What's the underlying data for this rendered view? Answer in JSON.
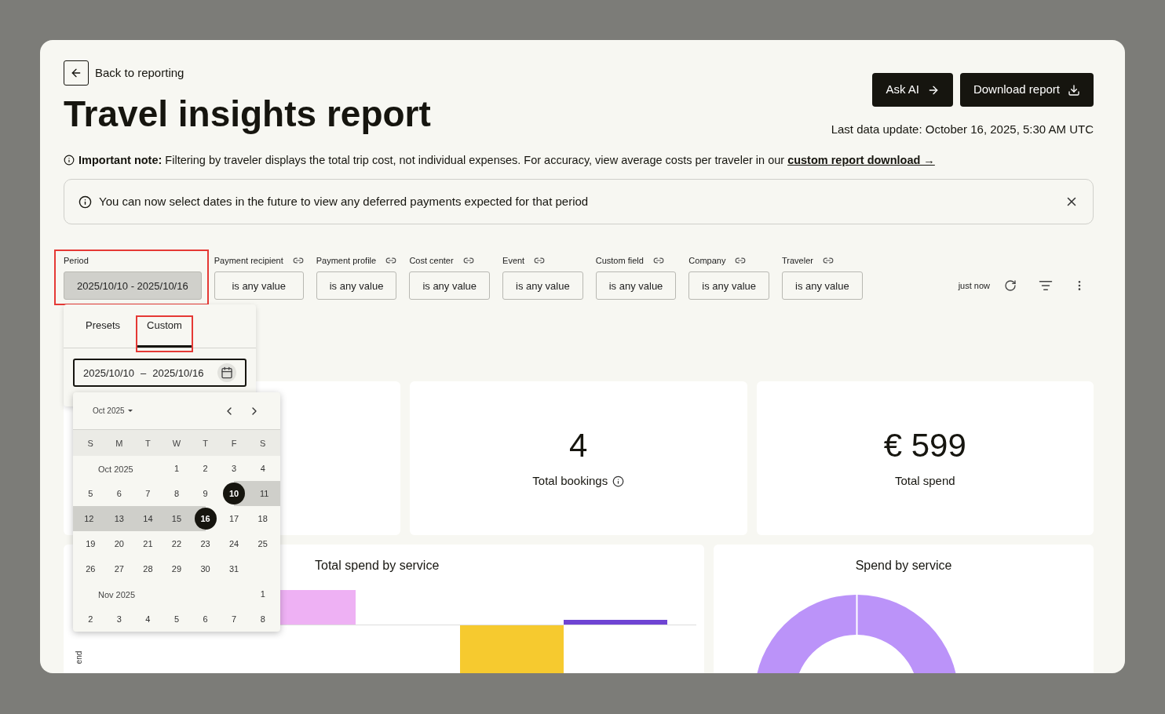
{
  "back_link": {
    "label": "Back to reporting"
  },
  "title": "Travel insights report",
  "actions": [
    {
      "label": "Ask AI",
      "kind": "arrow"
    },
    {
      "label": "Download report",
      "kind": "download"
    }
  ],
  "last_update": "Last data update: October 16, 2025, 5:30 AM UTC",
  "note": {
    "text": "**Important note:** Filtering by traveler displays the total trip cost, not individual expenses. For accuracy, view average costs per traveler in our",
    "link": "custom report download →"
  },
  "banner": {
    "text": "You can now select dates in the future to view any deferred payments expected for that period"
  },
  "filters": [
    {
      "label": "Period",
      "value": "2025/10/10 - 2025/10/16",
      "kind": "period",
      "linked": false,
      "highlighted": true
    },
    {
      "label": "Payment recipient",
      "value": "is any value",
      "kind": "filter",
      "linked": true,
      "highlighted": false
    },
    {
      "label": "Payment profile",
      "value": "is any value",
      "kind": "filter",
      "linked": true,
      "highlighted": false
    },
    {
      "label": "Cost center",
      "value": "is any value",
      "kind": "filter",
      "linked": true,
      "highlighted": false
    },
    {
      "label": "Event",
      "value": "is any value",
      "kind": "filter",
      "linked": true,
      "highlighted": false
    },
    {
      "label": "Custom field",
      "value": "is any value",
      "kind": "filter",
      "linked": true,
      "highlighted": false
    },
    {
      "label": "Company",
      "value": "is any value",
      "kind": "filter",
      "linked": true,
      "highlighted": false
    },
    {
      "label": "Traveler",
      "value": "is any value",
      "kind": "filter",
      "linked": true,
      "highlighted": false
    }
  ],
  "refresh": {
    "label": "just now"
  },
  "period_popover": {
    "tabs": [
      {
        "label": "Presets",
        "selected": false,
        "highlighted": false
      },
      {
        "label": "Custom",
        "selected": true,
        "highlighted": true
      }
    ],
    "start": "2025/10/10",
    "separator": "–",
    "end": "2025/10/16"
  },
  "calendar": {
    "month_label": "Oct 2025",
    "weekdays": [
      "S",
      "M",
      "T",
      "W",
      "T",
      "F",
      "S"
    ],
    "months": [
      {
        "label": "Oct 2025",
        "weeks": [
          {
            "kind": "lead",
            "days": [
              {
                "day": "1",
                "selected": false,
                "in_range": false
              },
              {
                "day": "2",
                "selected": false,
                "in_range": false
              },
              {
                "day": "3",
                "selected": false,
                "in_range": false
              },
              {
                "day": "4",
                "selected": false,
                "in_range": false
              }
            ]
          },
          {
            "kind": "full",
            "days": [
              {
                "day": "5",
                "selected": false,
                "in_range": false
              },
              {
                "day": "6",
                "selected": false,
                "in_range": false
              },
              {
                "day": "7",
                "selected": false,
                "in_range": false
              },
              {
                "day": "8",
                "selected": false,
                "in_range": false
              },
              {
                "day": "9",
                "selected": false,
                "in_range": false
              },
              {
                "day": "10",
                "selected": true,
                "in_range": true
              },
              {
                "day": "11",
                "selected": false,
                "in_range": true
              }
            ]
          },
          {
            "kind": "full",
            "days": [
              {
                "day": "12",
                "selected": false,
                "in_range": true
              },
              {
                "day": "13",
                "selected": false,
                "in_range": true
              },
              {
                "day": "14",
                "selected": false,
                "in_range": true
              },
              {
                "day": "15",
                "selected": false,
                "in_range": true
              },
              {
                "day": "16",
                "selected": true,
                "in_range": true
              },
              {
                "day": "17",
                "selected": false,
                "in_range": false
              },
              {
                "day": "18",
                "selected": false,
                "in_range": false
              }
            ]
          },
          {
            "kind": "full",
            "days": [
              {
                "day": "19",
                "selected": false,
                "in_range": false
              },
              {
                "day": "20",
                "selected": false,
                "in_range": false
              },
              {
                "day": "21",
                "selected": false,
                "in_range": false
              },
              {
                "day": "22",
                "selected": false,
                "in_range": false
              },
              {
                "day": "23",
                "selected": false,
                "in_range": false
              },
              {
                "day": "24",
                "selected": false,
                "in_range": false
              },
              {
                "day": "25",
                "selected": false,
                "in_range": false
              }
            ]
          },
          {
            "kind": "trail",
            "days": [
              {
                "day": "26",
                "selected": false,
                "in_range": false
              },
              {
                "day": "27",
                "selected": false,
                "in_range": false
              },
              {
                "day": "28",
                "selected": false,
                "in_range": false
              },
              {
                "day": "29",
                "selected": false,
                "in_range": false
              },
              {
                "day": "30",
                "selected": false,
                "in_range": false
              },
              {
                "day": "31",
                "selected": false,
                "in_range": false
              }
            ]
          }
        ]
      },
      {
        "label": "Nov 2025",
        "weeks": [
          {
            "kind": "lead",
            "days": [
              {
                "day": "1",
                "selected": false,
                "in_range": false
              }
            ]
          },
          {
            "kind": "full",
            "days": [
              {
                "day": "2",
                "selected": false,
                "in_range": false
              },
              {
                "day": "3",
                "selected": false,
                "in_range": false
              },
              {
                "day": "4",
                "selected": false,
                "in_range": false
              },
              {
                "day": "5",
                "selected": false,
                "in_range": false
              },
              {
                "day": "6",
                "selected": false,
                "in_range": false
              },
              {
                "day": "7",
                "selected": false,
                "in_range": false
              },
              {
                "day": "8",
                "selected": false,
                "in_range": false
              }
            ]
          }
        ]
      }
    ]
  },
  "kpis": [
    {
      "value": "4",
      "label": "Total bookings",
      "info": true
    },
    {
      "value": "€ 599",
      "label": "Total spend",
      "info": false
    }
  ],
  "charts": [
    {
      "title": "Total spend by service",
      "kind": "bar",
      "axis_label": "end"
    },
    {
      "title": "Spend by service",
      "kind": "donut"
    }
  ]
}
